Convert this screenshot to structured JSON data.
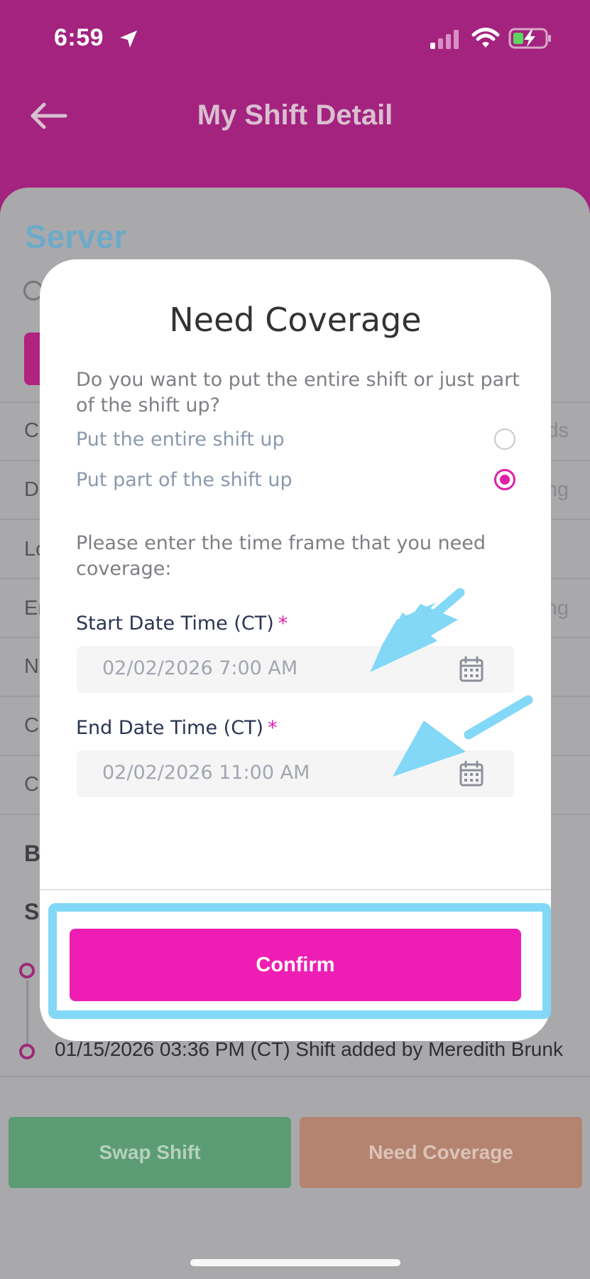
{
  "status_bar": {
    "time": "6:59"
  },
  "header": {
    "title": "My Shift Detail"
  },
  "background": {
    "role": "Server",
    "paren_fragment": ")",
    "row_letters": [
      "C",
      "D",
      "Lo",
      "Er",
      "N",
      "C",
      "C"
    ],
    "row_right_fragments": [
      "ds",
      "ng",
      "",
      "ng",
      "",
      "",
      ""
    ],
    "section_b": "B",
    "section_s": "S",
    "history_entry": "01/15/2026 03:36 PM (CT) Shift added by Meredith Brunk"
  },
  "modal": {
    "title": "Need Coverage",
    "question": "Do you want to put the entire shift or just part of the shift up?",
    "options": [
      {
        "label": "Put the entire shift up",
        "selected": false
      },
      {
        "label": "Put part of the shift up",
        "selected": true
      }
    ],
    "instruction": "Please enter the time frame that you need coverage:",
    "start": {
      "label": "Start Date Time (CT)",
      "required_mark": "*",
      "value": "02/02/2026 7:00 AM"
    },
    "end": {
      "label": "End Date Time (CT)",
      "required_mark": "*",
      "value": "02/02/2026 11:00 AM"
    },
    "confirm_label": "Confirm"
  },
  "bottom_actions": {
    "swap_label": "Swap Shift",
    "coverage_label": "Need Coverage"
  },
  "icons": {
    "status": [
      "location-arrow-icon",
      "cellular-signal-icon",
      "wifi-icon",
      "battery-charging-icon"
    ],
    "header": [
      "back-arrow-icon"
    ],
    "fields": [
      "calendar-icon"
    ]
  },
  "colors": {
    "header_bg": "#a3237f",
    "accent_pink": "#ee1eb4",
    "annotation_blue": "#82d8f6",
    "swap_green": "#5c9c74",
    "coverage_tan": "#b48470",
    "role_blue": "#6eaac8"
  }
}
